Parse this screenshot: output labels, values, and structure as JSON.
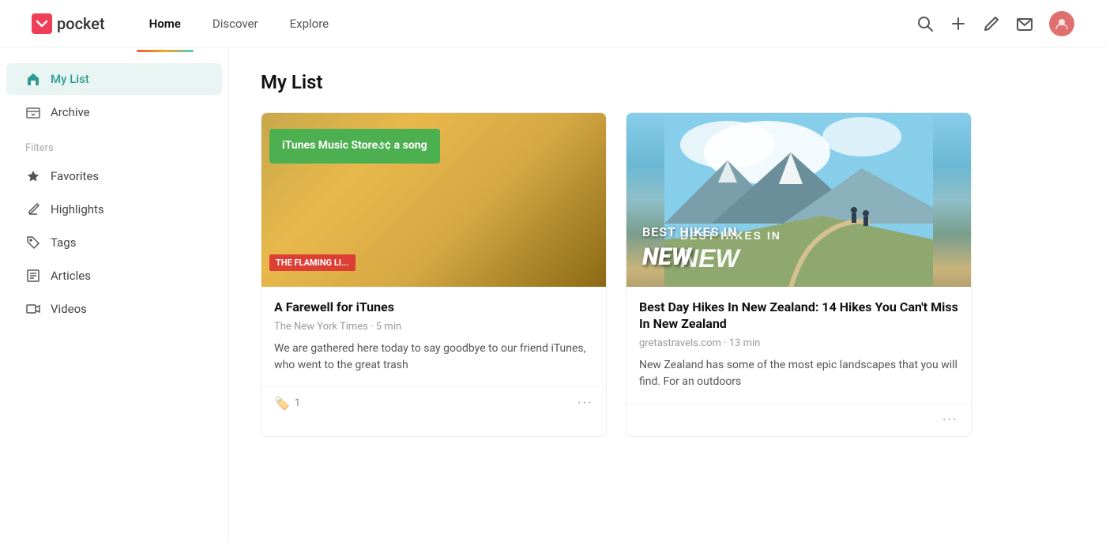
{
  "header": {
    "logo_text": "pocket",
    "nav": [
      {
        "label": "Home",
        "active": true
      },
      {
        "label": "Discover",
        "active": false
      },
      {
        "label": "Explore",
        "active": false
      }
    ]
  },
  "sidebar": {
    "main_items": [
      {
        "id": "my-list",
        "label": "My List",
        "active": true
      },
      {
        "id": "archive",
        "label": "Archive",
        "active": false
      }
    ],
    "filters_label": "Filters",
    "filter_items": [
      {
        "id": "favorites",
        "label": "Favorites"
      },
      {
        "id": "highlights",
        "label": "Highlights"
      },
      {
        "id": "tags",
        "label": "Tags"
      },
      {
        "id": "articles",
        "label": "Articles"
      },
      {
        "id": "videos",
        "label": "Videos"
      }
    ]
  },
  "main": {
    "page_title": "My List",
    "cards": [
      {
        "id": "card-1",
        "title": "A Farewell for iTunes",
        "source": "The New York Times",
        "read_time": "5 min",
        "excerpt": "We are gathered here today to say goodbye to our friend iTunes, who went to the great trash",
        "tag_count": "1"
      },
      {
        "id": "card-2",
        "title": "Best Day Hikes In New Zealand: 14 Hikes You Can't Miss In New Zealand",
        "source": "gretastravels.com",
        "read_time": "13 min",
        "excerpt": "New Zealand has some of the most epic landscapes that you will find. For an outdoors"
      }
    ]
  }
}
